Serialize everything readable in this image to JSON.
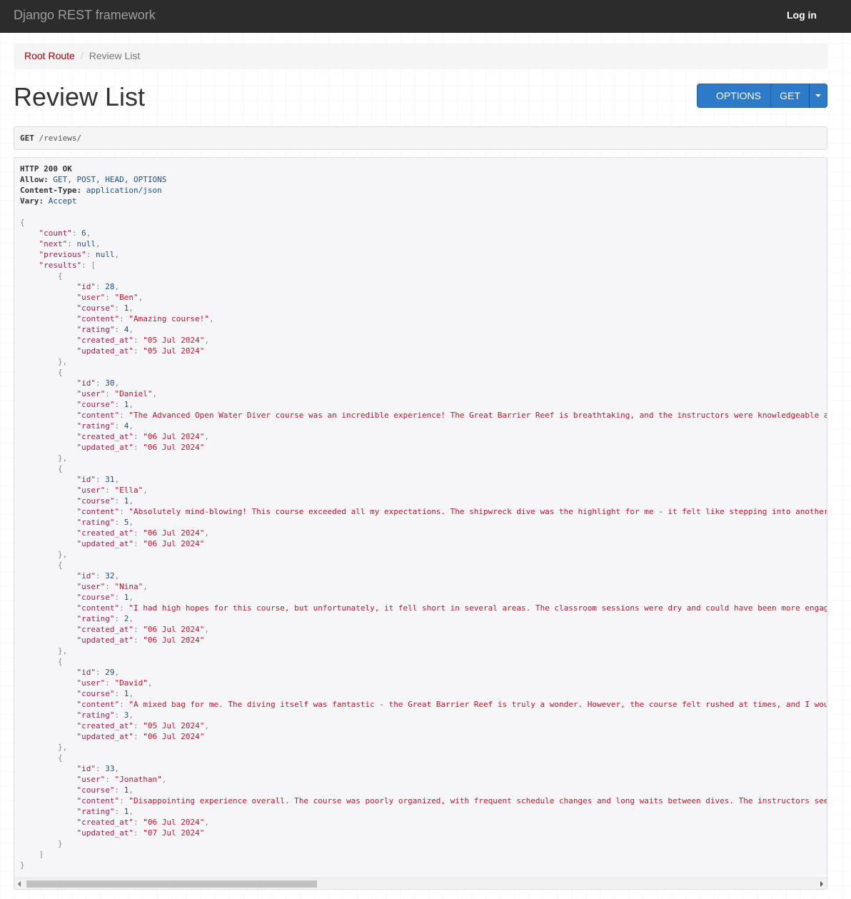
{
  "navbar": {
    "brand": "Django REST framework",
    "login": "Log in"
  },
  "breadcrumb": {
    "root": "Root Route",
    "separator": "/",
    "current": "Review List"
  },
  "page_title": "Review List",
  "buttons": {
    "options": "OPTIONS",
    "get": "GET"
  },
  "request": {
    "method": "GET",
    "path": "/reviews/"
  },
  "response": {
    "status": "HTTP 200 OK",
    "headers": [
      {
        "key": "Allow:",
        "value": "GET, POST, HEAD, OPTIONS"
      },
      {
        "key": "Content-Type:",
        "value": "application/json"
      },
      {
        "key": "Vary:",
        "value": "Accept"
      }
    ],
    "body": {
      "count": 6,
      "next": null,
      "previous": null,
      "results": [
        {
          "id": 28,
          "user": "Ben",
          "course": 1,
          "content": "Amazing course!",
          "rating": 4,
          "created_at": "05 Jul 2024",
          "updated_at": "05 Jul 2024"
        },
        {
          "id": 30,
          "user": "Daniel",
          "course": 1,
          "content": "The Advanced Open Water Diver course was an incredible experience! The Great Barrier Reef is breathtaking, and the instructors were knowledgeable an",
          "rating": 4,
          "created_at": "06 Jul 2024",
          "updated_at": "06 Jul 2024"
        },
        {
          "id": 31,
          "user": "Ella",
          "course": 1,
          "content": "Absolutely mind-blowing! This course exceeded all my expectations. The shipwreck dive was the highlight for me - it felt like stepping into another",
          "rating": 5,
          "created_at": "06 Jul 2024",
          "updated_at": "06 Jul 2024"
        },
        {
          "id": 32,
          "user": "Nina",
          "course": 1,
          "content": "I had high hopes for this course, but unfortunately, it fell short in several areas. The classroom sessions were dry and could have been more engagi",
          "rating": 2,
          "created_at": "06 Jul 2024",
          "updated_at": "06 Jul 2024"
        },
        {
          "id": 29,
          "user": "David",
          "course": 1,
          "content": "A mixed bag for me. The diving itself was fantastic - the Great Barrier Reef is truly a wonder. However, the course felt rushed at times, and I woul",
          "rating": 3,
          "created_at": "05 Jul 2024",
          "updated_at": "06 Jul 2024"
        },
        {
          "id": 33,
          "user": "Jonathan",
          "course": 1,
          "content": "Disappointing experience overall. The course was poorly organized, with frequent schedule changes and long waits between dives. The instructors seem",
          "rating": 1,
          "created_at": "06 Jul 2024",
          "updated_at": "07 Jul 2024"
        }
      ]
    }
  },
  "icons": {
    "caret": "caret-down-icon",
    "scroll_left": "arrow-left-icon",
    "scroll_right": "arrow-right-icon"
  }
}
